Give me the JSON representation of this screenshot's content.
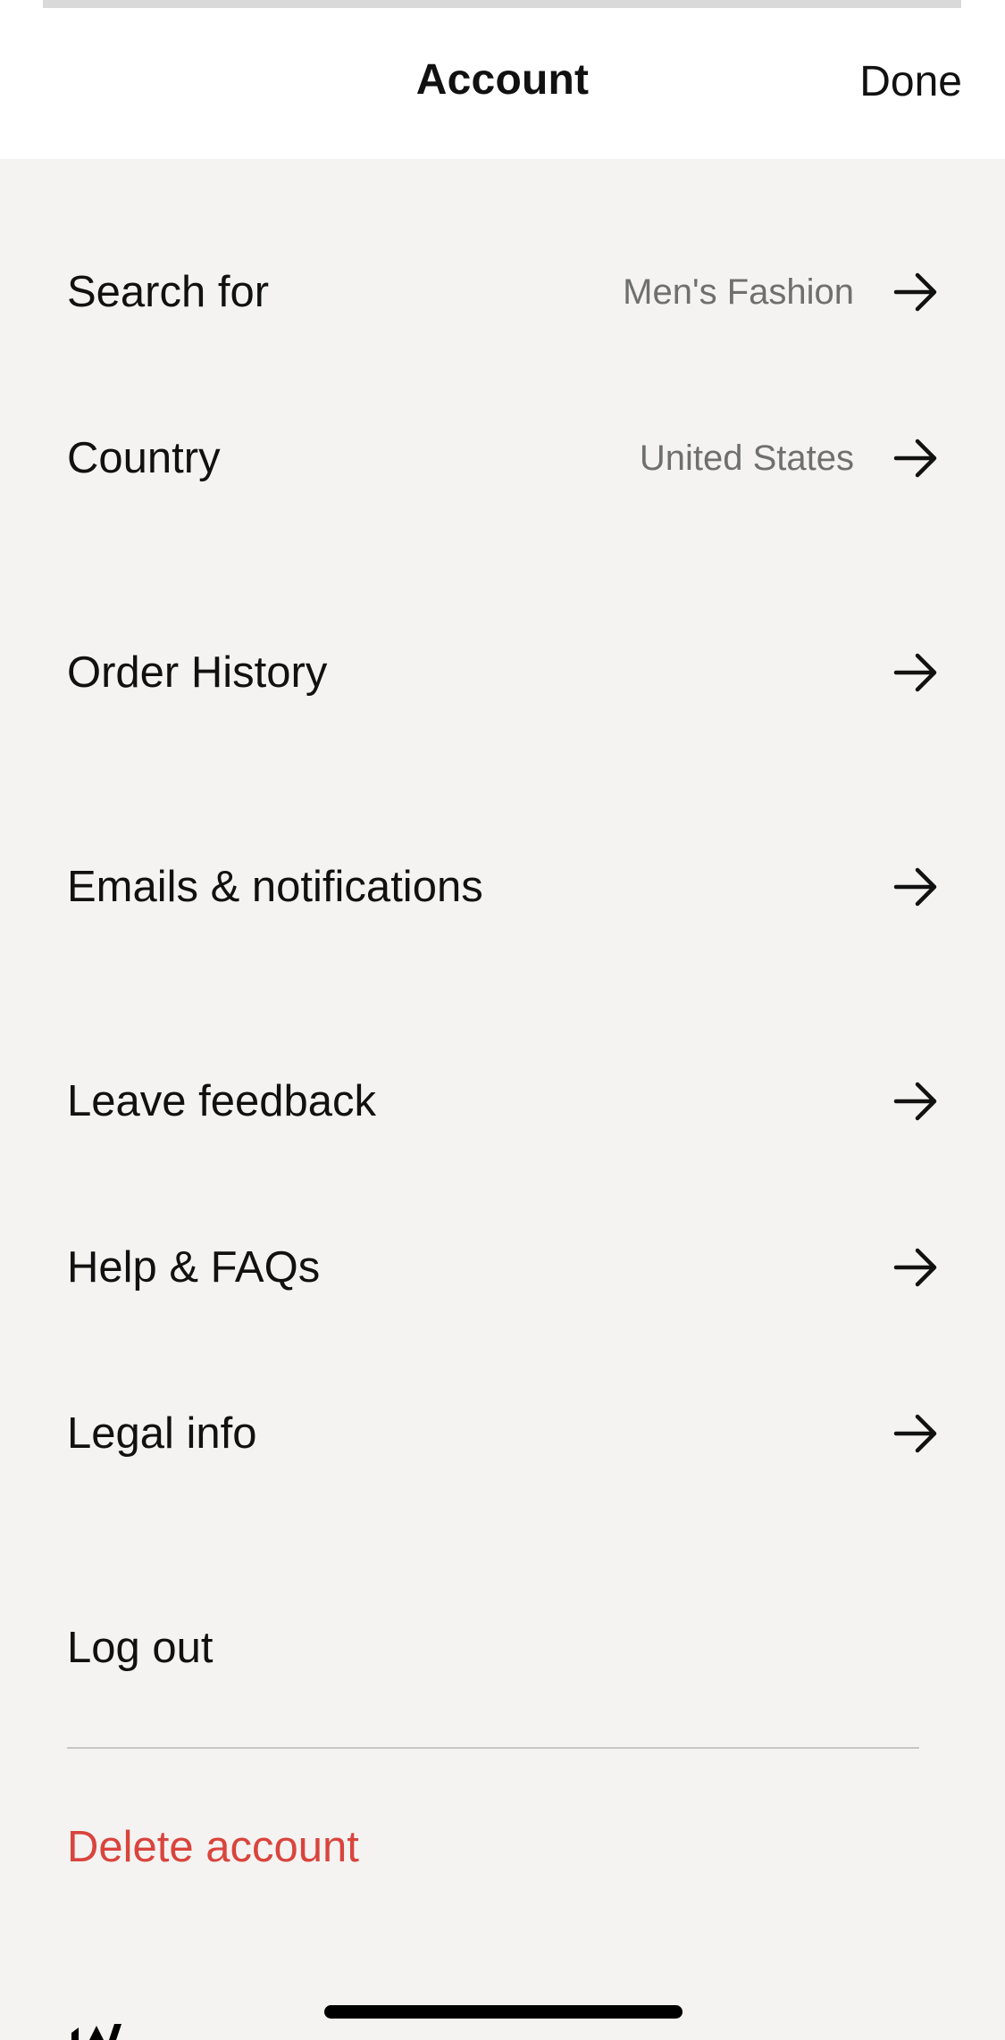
{
  "header": {
    "title": "Account",
    "done_label": "Done"
  },
  "menu": {
    "items": [
      {
        "label": "Search for",
        "value": "Men's Fashion"
      },
      {
        "label": "Country",
        "value": "United States"
      },
      {
        "label": "Order History"
      },
      {
        "label": "Emails & notifications"
      },
      {
        "label": "Leave feedback"
      },
      {
        "label": "Help & FAQs"
      },
      {
        "label": "Legal info"
      }
    ],
    "logout_label": "Log out",
    "delete_label": "Delete account"
  },
  "colors": {
    "background": "#f4f3f1",
    "header_background": "#ffffff",
    "destructive": "#d9443d",
    "secondary_text": "#6f6f6f"
  },
  "icons": {
    "row_arrow": "arrow-right-icon"
  }
}
